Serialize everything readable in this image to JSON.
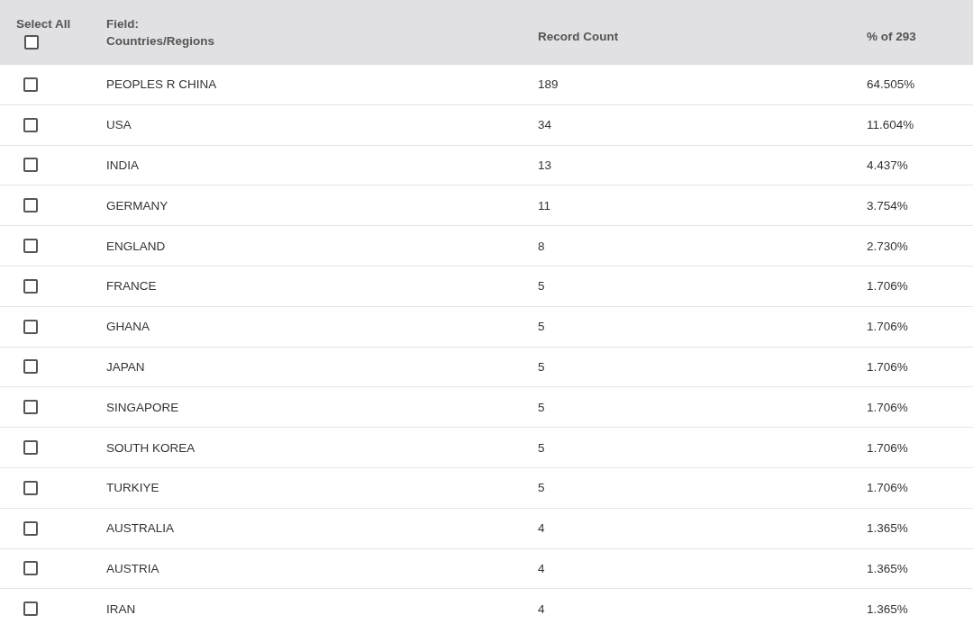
{
  "header": {
    "select_all": {
      "label": "Select All",
      "checked": false
    },
    "field_label": "Field:",
    "field_name": "Countries/Regions",
    "count_label": "Record Count",
    "percent_label": "% of 293"
  },
  "rows": [
    {
      "name": "PEOPLES R CHINA",
      "count": "189",
      "percent": "64.505%",
      "checked": false
    },
    {
      "name": "USA",
      "count": "34",
      "percent": "11.604%",
      "checked": false
    },
    {
      "name": "INDIA",
      "count": "13",
      "percent": "4.437%",
      "checked": false
    },
    {
      "name": "GERMANY",
      "count": "11",
      "percent": "3.754%",
      "checked": false
    },
    {
      "name": "ENGLAND",
      "count": "8",
      "percent": "2.730%",
      "checked": false
    },
    {
      "name": "FRANCE",
      "count": "5",
      "percent": "1.706%",
      "checked": false
    },
    {
      "name": "GHANA",
      "count": "5",
      "percent": "1.706%",
      "checked": false
    },
    {
      "name": "JAPAN",
      "count": "5",
      "percent": "1.706%",
      "checked": false
    },
    {
      "name": "SINGAPORE",
      "count": "5",
      "percent": "1.706%",
      "checked": false
    },
    {
      "name": "SOUTH KOREA",
      "count": "5",
      "percent": "1.706%",
      "checked": false
    },
    {
      "name": "TURKIYE",
      "count": "5",
      "percent": "1.706%",
      "checked": false
    },
    {
      "name": "AUSTRALIA",
      "count": "4",
      "percent": "1.365%",
      "checked": false
    },
    {
      "name": "AUSTRIA",
      "count": "4",
      "percent": "1.365%",
      "checked": false
    },
    {
      "name": "IRAN",
      "count": "4",
      "percent": "1.365%",
      "checked": false
    }
  ]
}
